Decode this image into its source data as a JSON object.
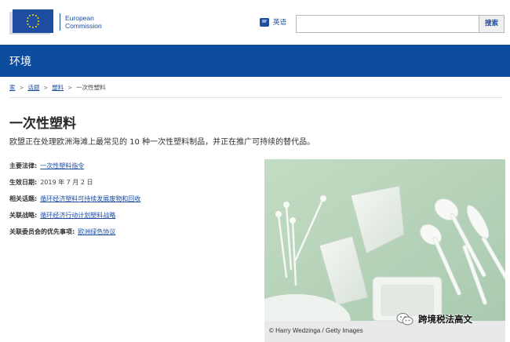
{
  "header": {
    "logo_line1": "European",
    "logo_line2": "Commission",
    "language_label": "英语",
    "search_placeholder": "",
    "search_button": "搜索"
  },
  "banner": {
    "title": "环境"
  },
  "breadcrumb": {
    "items": [
      "家",
      "话题",
      "塑料",
      "一次性塑料"
    ],
    "separator": ">"
  },
  "page": {
    "title": "一次性塑料",
    "lead": "欧盟正在处理欧洲海滩上最常见的 10 种一次性塑料制品，并正在推广可持续的替代品。"
  },
  "meta": [
    {
      "key": "主要法律:",
      "value": "一次性塑料指令",
      "is_link": true
    },
    {
      "key": "生效日期:",
      "value": "2019 年 7 月 2 日",
      "is_link": false
    },
    {
      "key": "相关话题:",
      "value": "循环经济塑料可持续发展废物和回收",
      "is_link": true
    },
    {
      "key": "关联战略:",
      "value": "循环经济行动计划塑料战略",
      "is_link": true
    },
    {
      "key": "关联委员会的优先事项:",
      "value": "欧洲绿色协议",
      "is_link": true
    }
  ],
  "image": {
    "caption": "© Harry Wedzinga / Getty Images"
  },
  "watermark": {
    "text": "跨境税法高文"
  },
  "colors": {
    "brand_blue": "#0b4c9e",
    "link_blue": "#1f4da0",
    "photo_bg": "#b7d3ba"
  }
}
